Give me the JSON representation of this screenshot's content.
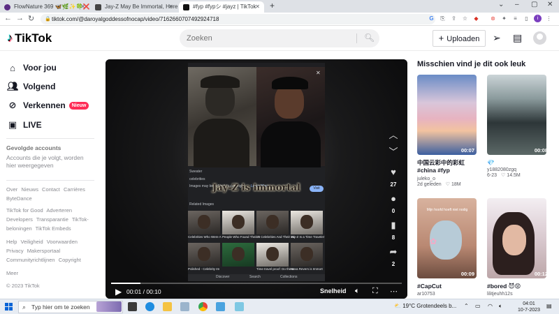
{
  "browser": {
    "tabs": [
      {
        "title": "FlowNature 369 🦋🌿✨🍀❌🦋"
      },
      {
        "title": "Jay-Z May Be Immortal, Here He"
      },
      {
        "title": "#fyp #fypシ #jayz | TikTok"
      }
    ],
    "new_tab": "+",
    "url": "tiktok.com/@daroyalgoddessofnocap/video/7162660707492924718"
  },
  "header": {
    "logo_text": "TikTok",
    "search_placeholder": "Zoeken",
    "upload_label": "Uploaden"
  },
  "sidebar": {
    "nav": [
      {
        "label": "Voor jou",
        "icon": "home-icon"
      },
      {
        "label": "Volgend",
        "icon": "users-icon"
      },
      {
        "label": "Verkennen",
        "icon": "compass-icon",
        "badge": "Nieuw"
      },
      {
        "label": "LIVE",
        "icon": "live-icon"
      }
    ],
    "following_title": "Gevolgde accounts",
    "following_sub": "Accounts die je volgt, worden hier weergegeven",
    "footer_groups": [
      [
        "Over",
        "Nieuws",
        "Contact",
        "Carrières",
        "ByteDance"
      ],
      [
        "TikTok for Good",
        "Adverteren",
        "Developers",
        "Transparantie",
        "TikTok-beloningen",
        "TikTok Embeds"
      ],
      [
        "Help",
        "Veiligheid",
        "Voorwaarden",
        "Privacy",
        "Makersportaal",
        "Communityrichtlijnen",
        "Copyright"
      ]
    ],
    "more": "Meer",
    "copyright": "© 2023 TikTok"
  },
  "video": {
    "overlay_title": "Jay-Z is immortal",
    "google_snippets": {
      "source": "Sweater",
      "line1": "celebrities",
      "line2": "Images may be subject to copyright.",
      "learn_more": "Learn More",
      "visit": "Visit",
      "related": "Related Images"
    },
    "thumb_captions": [
      "Celebrities Who Were A",
      "People Who Found Their T",
      "15 Celebrities And Their Wi",
      "Jay-Z Is a Time Traveler",
      "Polished - Celebrity Im",
      "Time travel proof: Do these",
      "Hova Revers is Immort"
    ],
    "gnav": [
      "Discover",
      "Search",
      "Collections"
    ],
    "progress": 0.1,
    "likes": "27",
    "comments": "0",
    "saves": "8",
    "shares": "2",
    "time_current": "00:01",
    "time_total": "00:10",
    "speed_label": "Snelheid"
  },
  "recommendations": {
    "title": "Misschien vind je dit ook leuk",
    "items": [
      {
        "duration": "00:07",
        "caption": "中国云彩中的彩虹 #china #fyp",
        "author": "juleko_o",
        "date": "2d geleden",
        "likes": "18M"
      },
      {
        "duration": "00:08",
        "caption": "💎",
        "author": "y1882080zgq",
        "date": "6-23",
        "likes": "14.5M"
      },
      {
        "duration": "00:09",
        "caption": "#CapCut",
        "author": "ar10753",
        "overlay": "Mijn hoofd hoeft niet nodig"
      },
      {
        "duration": "00:12",
        "caption": "#bored 😈😡",
        "author": "lilitjeuhh12s"
      }
    ]
  },
  "taskbar": {
    "search_placeholder": "Typ hier om te zoeken",
    "weather": "19°C  Grotendeels b...",
    "time": "04:01",
    "date": "10-7-2023"
  }
}
